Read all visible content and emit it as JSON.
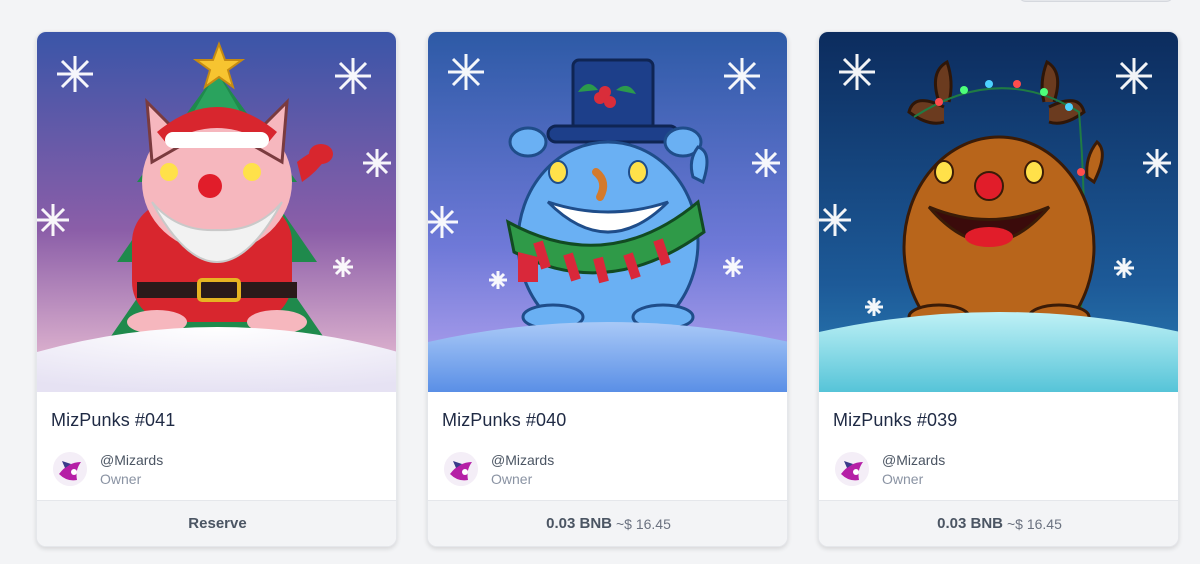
{
  "items": [
    {
      "title": "MizPunks #041",
      "owner_handle": "@Mizards",
      "owner_role": "Owner",
      "action_label": "Reserve",
      "art_icon": "santa-pig-icon",
      "art_bg_top": "#3a55a8",
      "art_bg_bottom": "#f2c7d8"
    },
    {
      "title": "MizPunks #040",
      "owner_handle": "@Mizards",
      "owner_role": "Owner",
      "price": "0.03 BNB",
      "usd": "~$ 16.45",
      "art_icon": "snowman-creature-icon",
      "art_bg_top": "#2d5aa6",
      "art_bg_bottom": "#b8a6f0"
    },
    {
      "title": "MizPunks #039",
      "owner_handle": "@Mizards",
      "owner_role": "Owner",
      "price": "0.03 BNB",
      "usd": "~$ 16.45",
      "art_icon": "reindeer-creature-icon",
      "art_bg_top": "#0c2c5e",
      "art_bg_bottom": "#2b7fb6"
    }
  ],
  "colors": {
    "page_bg": "#f3f4f6",
    "card_bg": "#ffffff",
    "footer_bg": "#f3f4f6",
    "title_text": "#1f2a44",
    "muted_text": "#8a93a3"
  }
}
